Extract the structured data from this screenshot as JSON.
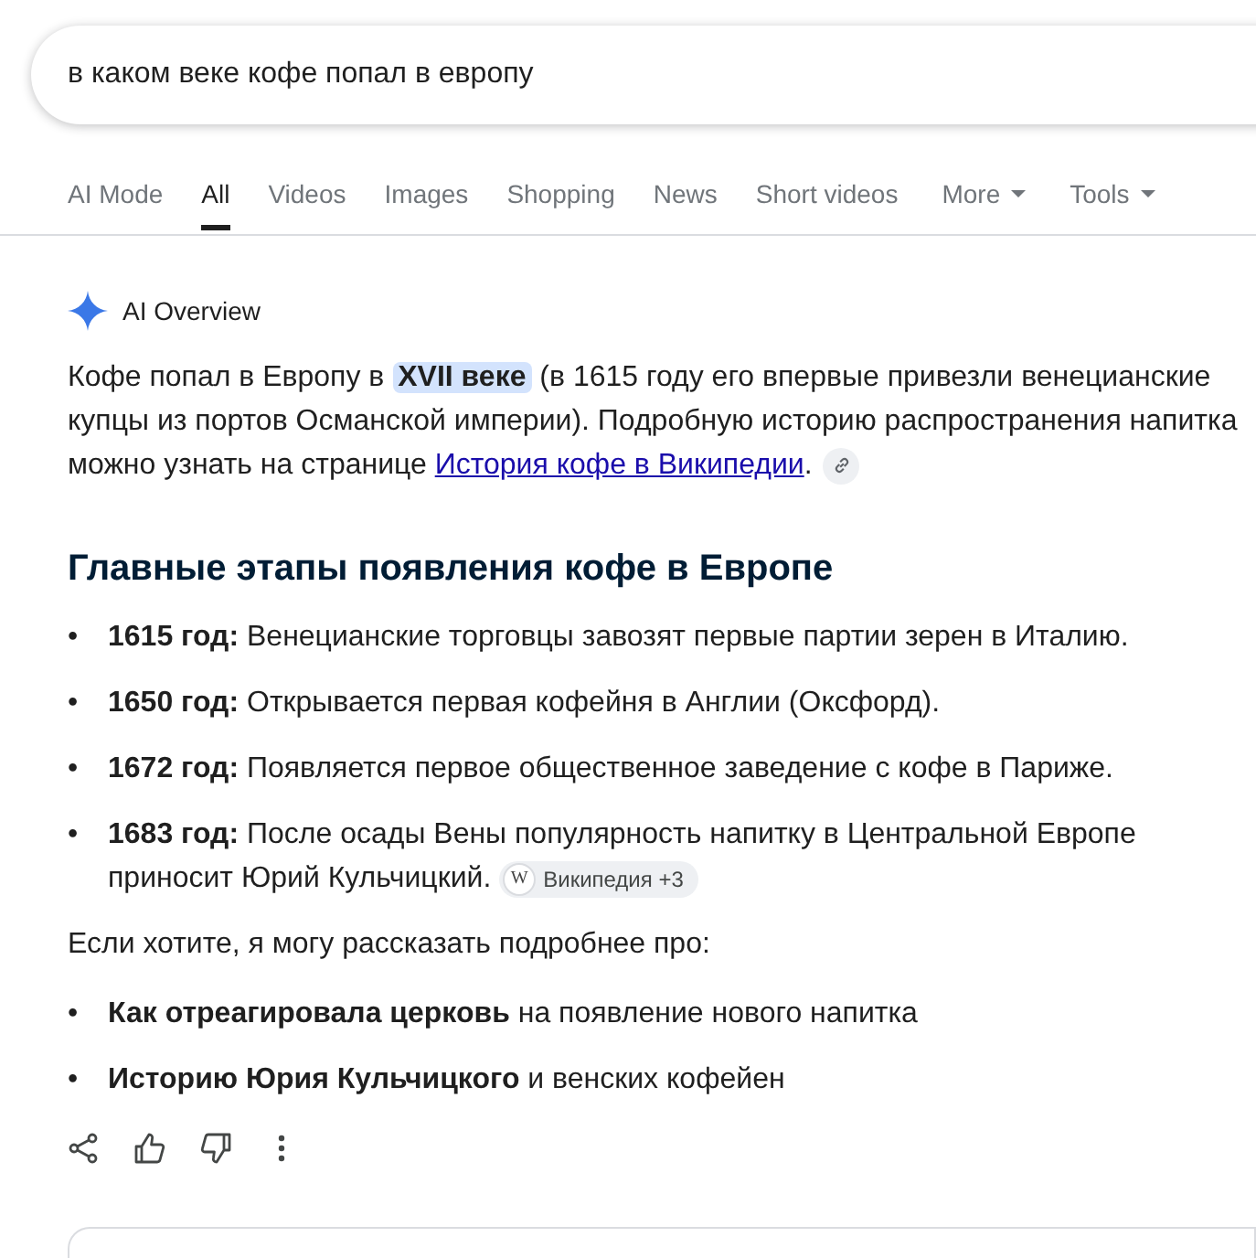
{
  "search": {
    "value": "в каком веке кофе попал в европу"
  },
  "tabs": [
    {
      "label": "AI Mode",
      "selected": false,
      "kind": "tab"
    },
    {
      "label": "All",
      "selected": true,
      "kind": "tab"
    },
    {
      "label": "Videos",
      "selected": false,
      "kind": "tab"
    },
    {
      "label": "Images",
      "selected": false,
      "kind": "tab"
    },
    {
      "label": "Shopping",
      "selected": false,
      "kind": "tab"
    },
    {
      "label": "News",
      "selected": false,
      "kind": "tab"
    },
    {
      "label": "Short videos",
      "selected": false,
      "kind": "tab"
    },
    {
      "label": "More",
      "selected": false,
      "kind": "menu"
    },
    {
      "label": "Tools",
      "selected": false,
      "kind": "menu"
    }
  ],
  "overview": {
    "title": "AI Overview",
    "intro": {
      "before": "Кофе попал в Европу в ",
      "highlight": "XVII веке",
      "middle": " (в 1615 году его впервые привезли венецианские купцы из портов Османской империи). Подробную историю распространения напитка можно узнать на странице ",
      "link": "История кофе в Википедии",
      "after": "."
    },
    "heading": "Главные этапы появления кофе в Европе",
    "milestones": [
      {
        "marker": "•",
        "text": "**1615 год:** Венецианские торговцы завозят первые партии зерен в Италию."
      },
      {
        "marker": "•",
        "text": "**1650 год:** Открывается первая кофейня в Англии (Оксфорд)."
      },
      {
        "marker": "•",
        "text": "**1672 год:** Появляется первое общественное заведение с кофе в Париже."
      },
      {
        "marker": "•",
        "text": "**1683 год:** После осады Вены популярность напитку в Центральной Европе приносит Юрий Кульчицкий.",
        "source": {
          "letter": "W",
          "label": "Википедия +3"
        }
      }
    ],
    "followup": "Если хотите, я могу рассказать подробнее про:",
    "topics": [
      {
        "marker": "•",
        "text": "**Как отреагировала церковь** на появление нового напитка"
      },
      {
        "marker": "•",
        "text": "**Историю Юрия Кульчицкого** и венских кофейен"
      }
    ]
  }
}
